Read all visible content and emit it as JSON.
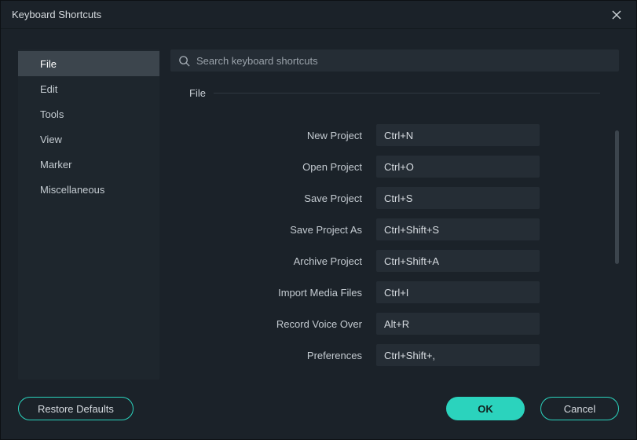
{
  "title": "Keyboard Shortcuts",
  "search": {
    "placeholder": "Search keyboard shortcuts"
  },
  "sidebar": {
    "items": [
      {
        "label": "File",
        "active": true
      },
      {
        "label": "Edit"
      },
      {
        "label": "Tools"
      },
      {
        "label": "View"
      },
      {
        "label": "Marker"
      },
      {
        "label": "Miscellaneous"
      }
    ]
  },
  "section": {
    "title": "File"
  },
  "shortcuts": [
    {
      "label": "New Project",
      "keys": "Ctrl+N"
    },
    {
      "label": "Open Project",
      "keys": "Ctrl+O"
    },
    {
      "label": "Save Project",
      "keys": "Ctrl+S"
    },
    {
      "label": "Save Project As",
      "keys": "Ctrl+Shift+S"
    },
    {
      "label": "Archive Project",
      "keys": "Ctrl+Shift+A"
    },
    {
      "label": "Import Media Files",
      "keys": "Ctrl+I"
    },
    {
      "label": "Record Voice Over",
      "keys": "Alt+R"
    },
    {
      "label": "Preferences",
      "keys": "Ctrl+Shift+,"
    }
  ],
  "footer": {
    "restore": "Restore Defaults",
    "ok": "OK",
    "cancel": "Cancel"
  }
}
